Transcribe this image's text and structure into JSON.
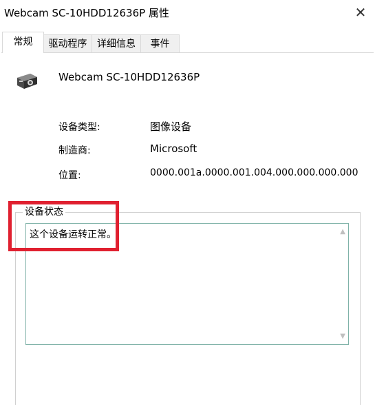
{
  "window": {
    "title": "Webcam SC-10HDD12636P 属性",
    "close_glyph": "✕"
  },
  "tabs": [
    {
      "label": "常规",
      "active": true
    },
    {
      "label": "驱动程序",
      "active": false
    },
    {
      "label": "详细信息",
      "active": false
    },
    {
      "label": "事件",
      "active": false
    }
  ],
  "device": {
    "icon": "webcam-icon",
    "name": "Webcam SC-10HDD12636P"
  },
  "properties": {
    "type_label": "设备类型:",
    "type_value": "图像设备",
    "manufacturer_label": "制造商:",
    "manufacturer_value": "Microsoft",
    "location_label": "位置:",
    "location_value": "0000.001a.0000.001.004.000.000.000.000"
  },
  "status": {
    "group_title": "设备状态",
    "text": "这个设备运转正常。"
  },
  "colors": {
    "highlight": "#e02030",
    "textbox_border": "#7fb2a8"
  }
}
